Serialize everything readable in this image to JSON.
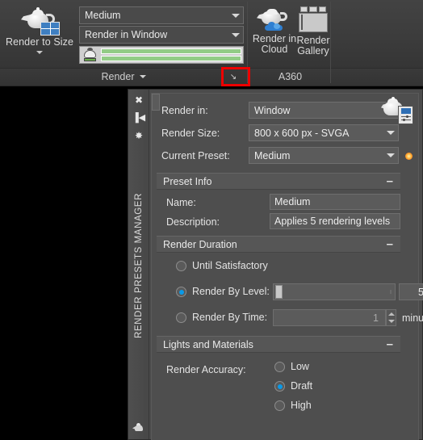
{
  "ribbon": {
    "render_to_size": {
      "label": "Render to Size",
      "icon": "teapot-size-icon"
    },
    "quality_combo": {
      "value": "Medium"
    },
    "destination_combo": {
      "value": "Render in Window"
    },
    "progress": {
      "icon": "teapot-progress-icon",
      "value": 100
    },
    "render_in_cloud": {
      "label_line1": "Render in",
      "label_line2": "Cloud",
      "icon": "teapot-cloud-icon"
    },
    "render_gallery": {
      "label_line1": "Render",
      "label_line2": "Gallery",
      "icon": "gallery-icon"
    },
    "panel_render_label": "Render",
    "panel_a360_label": "A360",
    "dialog_launcher": {
      "glyph": "↘",
      "highlight_color": "#ee0000"
    }
  },
  "palette": {
    "title": "RENDER PRESETS MANAGER",
    "side_icons": [
      {
        "name": "close-icon",
        "glyph": "✖"
      },
      {
        "name": "auto-hide-icon",
        "glyph": "▐◀"
      },
      {
        "name": "properties-icon",
        "glyph": "✸"
      }
    ],
    "bottom_icon": "teapot-icon",
    "header_icon": "teapot-properties-icon",
    "form": {
      "render_in": {
        "label": "Render in:",
        "value": "Window"
      },
      "render_size": {
        "label": "Render Size:",
        "value": "800 x 600 px - SVGA"
      },
      "current_preset": {
        "label": "Current Preset:",
        "value": "Medium"
      },
      "create_copy_icon": "sun-create-copy-icon",
      "delete_icon": "delete-preset-icon"
    },
    "preset_info": {
      "header": "Preset Info",
      "collapse_glyph": "–",
      "name_label": "Name:",
      "name_value": "Medium",
      "description_label": "Description:",
      "description_value": "Applies 5 rendering levels"
    },
    "render_duration": {
      "header": "Render Duration",
      "collapse_glyph": "–",
      "options": [
        {
          "label": "Until Satisfactory",
          "selected": false
        },
        {
          "label": "Render By Level:",
          "selected": true
        },
        {
          "label": "Render By Time:",
          "selected": false
        }
      ],
      "level_value": "5",
      "time_value": "1",
      "time_unit": "minutes"
    },
    "lights_and_materials": {
      "header": "Lights and Materials",
      "collapse_glyph": "–",
      "accuracy_label": "Render Accuracy:",
      "options": [
        {
          "label": "Low",
          "selected": false
        },
        {
          "label": "Draft",
          "selected": true
        },
        {
          "label": "High",
          "selected": false
        }
      ]
    }
  },
  "colors": {
    "accent_blue": "#0a9ae8",
    "highlight_red": "#ee0000",
    "progress_green": "#92cc86",
    "ribbon_bg": "#3b3b3b",
    "palette_bg": "#4e4e4e"
  }
}
